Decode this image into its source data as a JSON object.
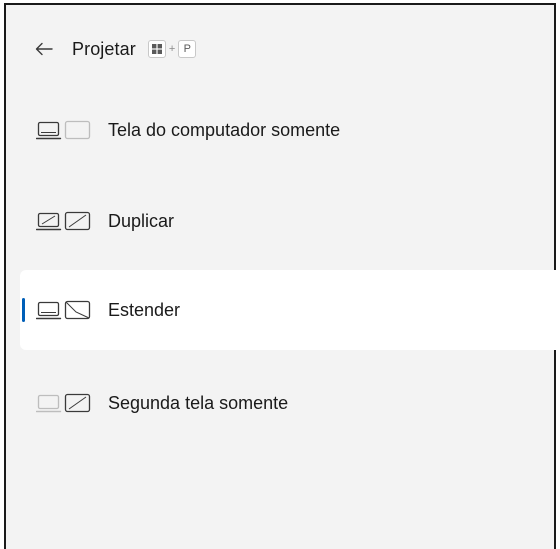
{
  "header": {
    "title": "Projetar",
    "shortcut_plus": "+",
    "shortcut_key": "P"
  },
  "options": [
    {
      "label": "Tela do computador somente",
      "icon": "pc-screen-only-icon"
    },
    {
      "label": "Duplicar",
      "icon": "duplicate-icon"
    },
    {
      "label": "Estender",
      "icon": "extend-icon",
      "selected": true
    },
    {
      "label": "Segunda tela somente",
      "icon": "second-screen-only-icon"
    }
  ],
  "colors": {
    "accent": "#005fb8",
    "panel_bg": "#f3f3f3",
    "selected_bg": "#ffffff"
  }
}
